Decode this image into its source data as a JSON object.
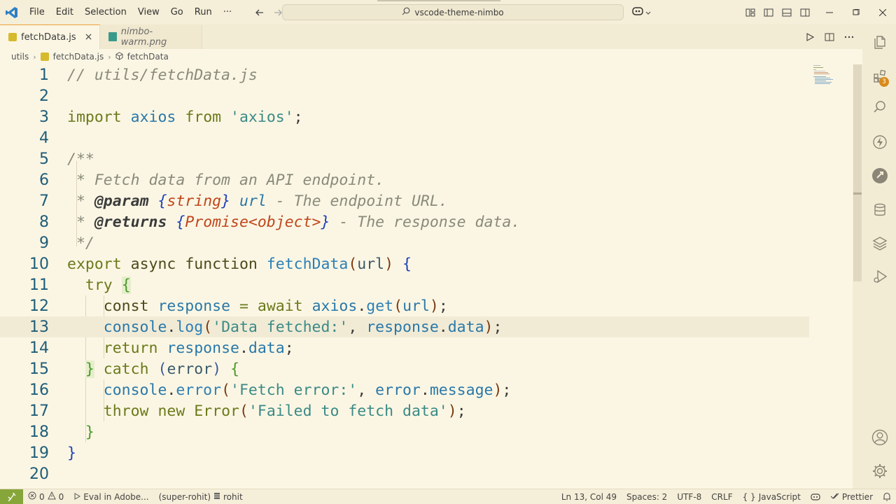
{
  "titlebar": {
    "menus": [
      "File",
      "Edit",
      "Selection",
      "View",
      "Go",
      "Run",
      "···"
    ],
    "search": "vscode-theme-nimbo"
  },
  "tabs": [
    {
      "label": "fetchData.js",
      "active": true
    },
    {
      "label": "nimbo-warm.png",
      "active": false
    }
  ],
  "breadcrumb": [
    "utils",
    "fetchData.js",
    "fetchData"
  ],
  "code": {
    "line_numbers": [
      "1",
      "2",
      "3",
      "4",
      "5",
      "6",
      "7",
      "8",
      "9",
      "10",
      "11",
      "12",
      "13",
      "14",
      "15",
      "16",
      "17",
      "18",
      "19",
      "20"
    ],
    "current_line": 13
  },
  "activity": {
    "extensions_badge": "3"
  },
  "status": {
    "errors": "0",
    "warnings": "0",
    "eval": "Eval in Adobe...",
    "user": "(super-rohit)",
    "db": "rohit",
    "position": "Ln 13, Col 49",
    "spaces": "Spaces: 2",
    "encoding": "UTF-8",
    "eol": "CRLF",
    "language": "JavaScript",
    "formatter": "Prettier"
  },
  "colors": {
    "accent": "#e9a23b",
    "remote": "#87a63a",
    "background": "#fbf6e4"
  }
}
